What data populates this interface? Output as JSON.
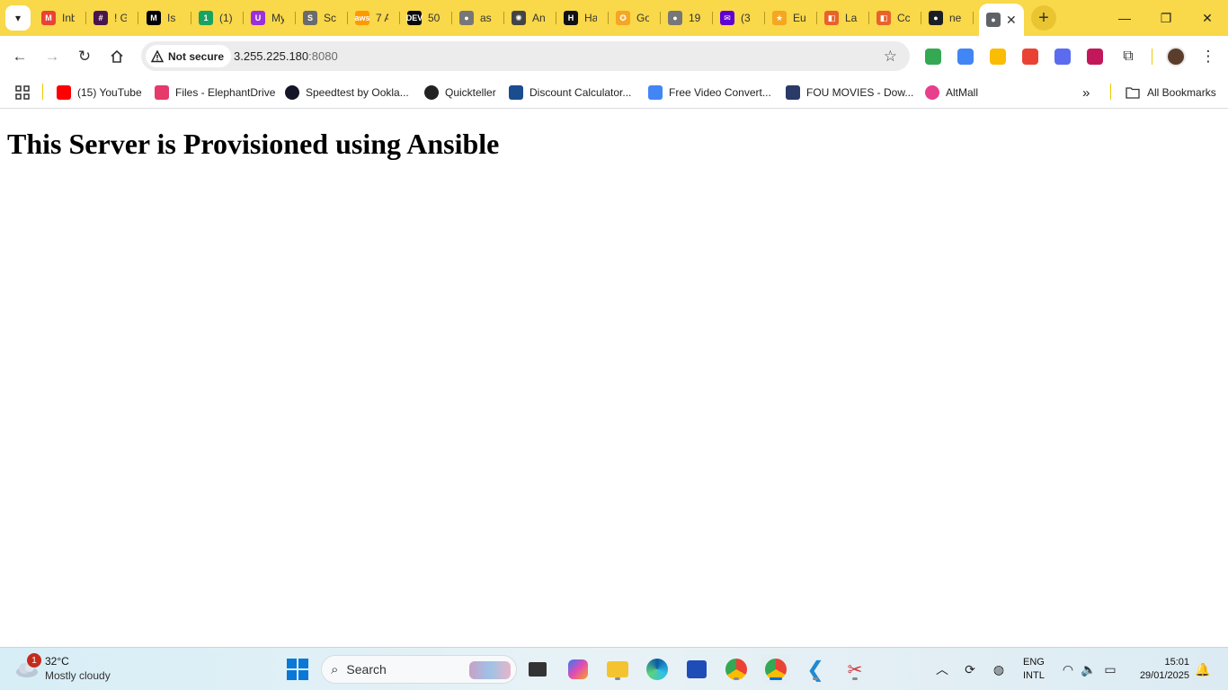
{
  "browser": {
    "tabs": [
      {
        "title": "Inbox",
        "favicon": "gmail-icon",
        "color": "#ea4335",
        "glyph": "M"
      },
      {
        "title": "! G",
        "favicon": "slack-icon",
        "color": "#4a154b",
        "glyph": "#"
      },
      {
        "title": "Is",
        "favicon": "medium-icon",
        "color": "#000000",
        "glyph": "M"
      },
      {
        "title": "(1)",
        "favicon": "green-circle-icon",
        "color": "#1aa260",
        "glyph": "1"
      },
      {
        "title": "My",
        "favicon": "purple-badge-icon",
        "color": "#9b30d9",
        "glyph": "U"
      },
      {
        "title": "Sc",
        "favicon": "school-icon",
        "color": "#6b6b6b",
        "glyph": "S"
      },
      {
        "title": "7 A",
        "favicon": "aws-icon",
        "color": "#ff9900",
        "glyph": "aws"
      },
      {
        "title": "50",
        "favicon": "dev-icon",
        "color": "#0a0a0a",
        "glyph": "DEV"
      },
      {
        "title": "as",
        "favicon": "globe-icon",
        "color": "#777777",
        "glyph": "●"
      },
      {
        "title": "An",
        "favicon": "openai-icon",
        "color": "#444444",
        "glyph": "✺"
      },
      {
        "title": "Ha",
        "favicon": "hashicorp-icon",
        "color": "#111111",
        "glyph": "H"
      },
      {
        "title": "Go",
        "favicon": "coin-icon",
        "color": "#f5a623",
        "glyph": "✪"
      },
      {
        "title": "19",
        "favicon": "globe-icon",
        "color": "#777777",
        "glyph": "●"
      },
      {
        "title": "(3",
        "favicon": "yahoo-mail-icon",
        "color": "#6001d2",
        "glyph": "✉"
      },
      {
        "title": "Eu",
        "favicon": "star-icon",
        "color": "#f5a623",
        "glyph": "★"
      },
      {
        "title": "La",
        "favicon": "orange-square-icon",
        "color": "#e8622c",
        "glyph": "◧"
      },
      {
        "title": "Cc",
        "favicon": "orange-square-icon",
        "color": "#e8622c",
        "glyph": "◧"
      },
      {
        "title": "ne",
        "favicon": "github-icon",
        "color": "#1b1f23",
        "glyph": "●"
      },
      {
        "title": "",
        "favicon": "globe-icon",
        "color": "#5f6368",
        "glyph": "●",
        "active": true
      }
    ],
    "address": {
      "security_label": "Not secure",
      "host": "3.255.225.180",
      "port": ":8080"
    },
    "extensions": [
      {
        "name": "google-drive-icon",
        "color": "#34a853"
      },
      {
        "name": "google-translate-icon",
        "color": "#4285f4"
      },
      {
        "name": "google-keep-icon",
        "color": "#fbbc04"
      },
      {
        "name": "colorful-grid-icon",
        "color": "#e94235"
      },
      {
        "name": "snowflake-icon",
        "color": "#5b6cf0"
      },
      {
        "name": "color-wheel-icon",
        "color": "#c2185b"
      }
    ],
    "bookmarks": [
      {
        "label": "(15) YouTube",
        "icon": "youtube-icon",
        "color": "#ff0000"
      },
      {
        "label": "Files - ElephantDrive",
        "icon": "elephantdrive-icon",
        "color": "#e53a6b"
      },
      {
        "label": "Speedtest by Ookla...",
        "icon": "speedtest-icon",
        "color": "#141526"
      },
      {
        "label": "Quickteller",
        "icon": "globe-icon",
        "color": "#222222"
      },
      {
        "label": "Discount Calculator...",
        "icon": "calculator-icon",
        "color": "#1a4d8f"
      },
      {
        "label": "Free Video Convert...",
        "icon": "google-icon",
        "color": "#4285f4"
      },
      {
        "label": "FOU MOVIES - Dow...",
        "icon": "fou-movies-icon",
        "color": "#2b3a67"
      },
      {
        "label": "AltMall",
        "icon": "altmall-icon",
        "color": "#e83e8c"
      }
    ],
    "all_bookmarks_label": "All Bookmarks"
  },
  "page": {
    "heading": "This Server is Provisioned using Ansible"
  },
  "taskbar": {
    "weather": {
      "temp": "32°C",
      "desc": "Mostly cloudy",
      "badge": "1"
    },
    "search_label": "Search",
    "language": {
      "line1": "ENG",
      "line2": "INTL"
    },
    "clock": {
      "time": "15:01",
      "date": "29/01/2025"
    }
  }
}
